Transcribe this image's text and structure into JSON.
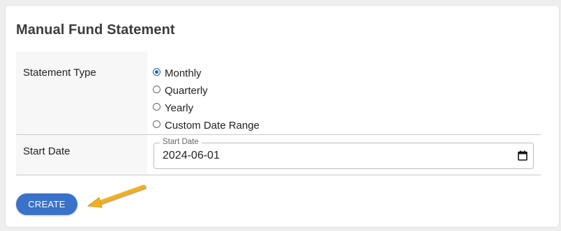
{
  "page": {
    "title": "Manual Fund Statement"
  },
  "form": {
    "statement_type": {
      "label": "Statement Type",
      "options": [
        {
          "label": "Monthly",
          "checked": true
        },
        {
          "label": "Quarterly",
          "checked": false
        },
        {
          "label": "Yearly",
          "checked": false
        },
        {
          "label": "Custom Date Range",
          "checked": false
        }
      ]
    },
    "start_date": {
      "label": "Start Date",
      "field_legend": "Start Date",
      "value": "2024-06-01",
      "icon": "calendar-icon"
    }
  },
  "actions": {
    "create_label": "CREATE"
  },
  "colors": {
    "accent": "#3a72c9",
    "radio_checked": "#1565c0",
    "annotation_arrow": "#f2b01e"
  }
}
